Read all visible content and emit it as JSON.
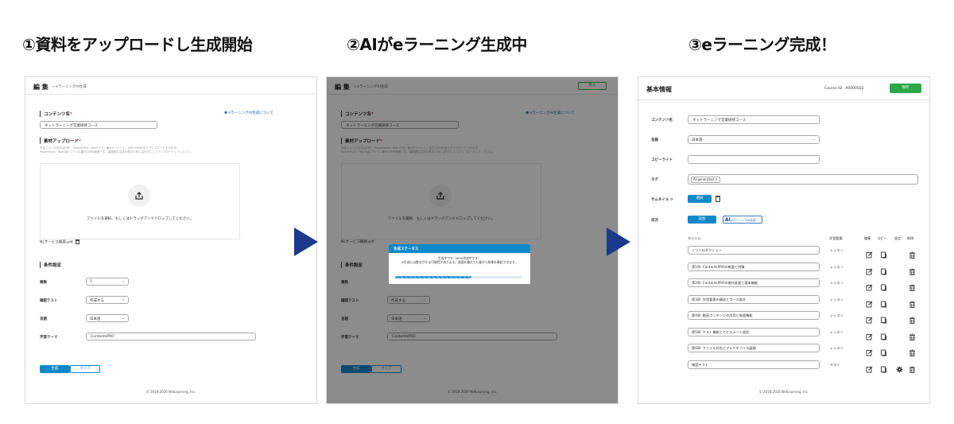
{
  "steps": [
    {
      "title": "①資料をアップロードし生成開始"
    },
    {
      "title": "②AIがeラーニング生成中"
    },
    {
      "title": "③eラーニング完成！"
    }
  ],
  "editor": {
    "header": "編 集",
    "breadcrumb": "»  eラーニングAI生成",
    "close_label": "閉る",
    "content_name_label": "コンテンツ名",
    "required_mark": "*",
    "about_link": "❶ eラーニングAI生成について",
    "content_name_value": "ネットラーニング営業研修コース",
    "upload_label": "素材アップロード",
    "upload_help_1": "対応ファイル形式はPDF・PowerPoint・Wordです。最大5ファイル、合計100MBまでアップロードできます。",
    "upload_help_2": "PowerPoint・Wordは1ファイル最大50MB程度です。高精度な生成を得るためにはPDFにしてアップロードしてください。",
    "drop_text": "ファイルを選択、もしくはドラッグアンドドロップしてください。",
    "uploaded_file": "NLサービス概要.pdf",
    "conditions_label": "条件設定",
    "chapters_label": "章数",
    "chapters_value": "5",
    "test_label": "確認テスト",
    "test_value": "作成する",
    "language_label": "言語",
    "language_value": "日本語",
    "theme_label": "学習テーマ",
    "theme_value": "ContentsPRO",
    "generate_btn": "生成",
    "clear_btn": "クリア",
    "footer": "© 2018-2026 NetLearning, Inc."
  },
  "modal": {
    "title": "生成ステータス",
    "line1": "生成中です（60%作成中です）",
    "line2": "※生成には数分かかる可能性があります。画面を離れても後から結果を確認できます。",
    "progress": 0.6
  },
  "basic": {
    "title": "基本情報",
    "course_id": "Course ID : A0000502",
    "save_btn": "保存",
    "content_name_label": "コンテンツ名",
    "content_name_value": "ネットラーニング営業研修コース",
    "language_label": "言語",
    "language_value": "日本語",
    "copyright_label": "コピーライト",
    "copyright_value": "",
    "tag_label": "タグ",
    "tag_value": "AI-generated ×",
    "thumbnail_label": "サムネイル ⑦",
    "select_btn": "選択",
    "toc_label": "目次",
    "add_btn": "追加",
    "ai_chip": "eラーニングAI生成",
    "ai_chip_logo": "AI",
    "cols": {
      "title": "タイトル",
      "type": "学習要素",
      "edit": "編集",
      "copy": "コピー",
      "settings": "設定",
      "delete": "削除"
    },
    "rows": [
      {
        "title": "イントロダクション",
        "type": "レッスン"
      },
      {
        "title": "第1章: ContentsPROの概要と特徴",
        "type": "レッスン"
      },
      {
        "title": "第2章: ContentsPROの操作画面と基本機能",
        "type": "レッスン"
      },
      {
        "title": "第3章: 学習要素の構成とコース設計",
        "type": "レッスン"
      },
      {
        "title": "第4章: 動画コンテンツの活用と制限機能",
        "type": "レッスン"
      },
      {
        "title": "第5章: テスト機能とアセスメント設定",
        "type": "レッスン"
      },
      {
        "title": "第6章: ファイル対応とマルチデバイス展開",
        "type": "レッスン"
      },
      {
        "title": "確認テスト",
        "type": "テスト"
      }
    ],
    "footer": "© 2018-2026 NetLearning, Inc."
  },
  "colors": {
    "arrow": "#1b3a8c",
    "primary": "#1188c8",
    "save": "#2aa84a"
  }
}
